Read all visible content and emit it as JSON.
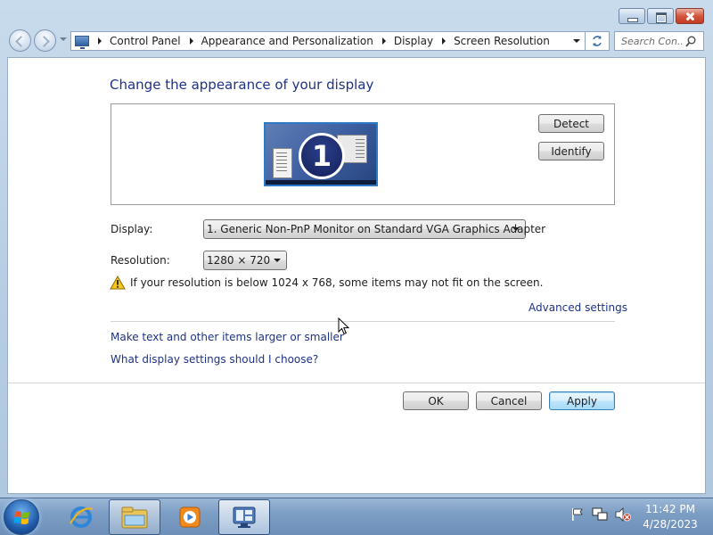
{
  "window": {
    "breadcrumbs": [
      "Control Panel",
      "Appearance and Personalization",
      "Display",
      "Screen Resolution"
    ],
    "search_placeholder": "Search Con..."
  },
  "page": {
    "title": "Change the appearance of your display",
    "monitor_number": "1",
    "detect_label": "Detect",
    "identify_label": "Identify",
    "display_label": "Display:",
    "display_value": "1. Generic Non-PnP Monitor on Standard VGA Graphics Adapter",
    "resolution_label": "Resolution:",
    "resolution_value": "1280 × 720",
    "warning_text": "If your resolution is below 1024 x 768, some items may not fit on the screen.",
    "advanced_link": "Advanced settings",
    "link_larger": "Make text and other items larger or smaller",
    "link_help": "What display settings should I choose?",
    "ok_label": "OK",
    "cancel_label": "Cancel",
    "apply_label": "Apply"
  },
  "taskbar": {
    "items": [
      "start-orb",
      "internet-explorer-icon",
      "windows-explorer-icon",
      "media-player-icon",
      "screen-resolution-icon"
    ],
    "tray_icons": [
      "flag-icon",
      "network-icon",
      "volume-muted-icon"
    ],
    "time": "11:42 PM",
    "date": "4/28/2023"
  },
  "colors": {
    "link": "#1e3287",
    "title": "#1e3287",
    "frame": "#b6cde3",
    "taskbar": "#7d9ec4"
  }
}
